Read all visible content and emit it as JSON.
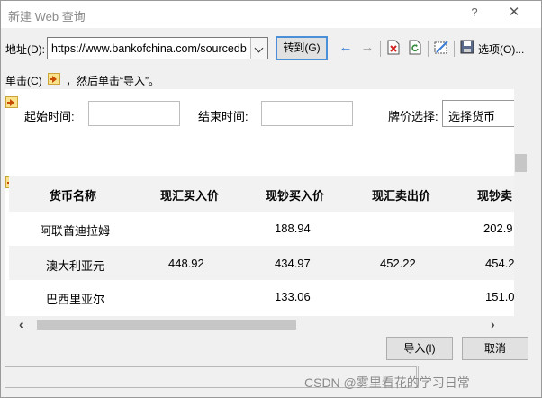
{
  "window": {
    "title": "新建 Web 查询",
    "help": "?",
    "close": "✕"
  },
  "toolbar": {
    "address_label": "地址(D):",
    "address_value": "https://www.bankofchina.com/sourcedb",
    "goto_label": "转到(G)",
    "options_label": "选项(O)..."
  },
  "hint": {
    "prefix": "单击(C)",
    "suffix": "，然后单击“导入”。"
  },
  "form": {
    "start_label": "起始时间:",
    "end_label": "结束时间:",
    "price_label": "牌价选择:",
    "currency_select": "选择货币"
  },
  "table": {
    "headers": [
      "货币名称",
      "现汇买入价",
      "现钞买入价",
      "现汇卖出价",
      "现钞卖"
    ],
    "rows": [
      [
        "阿联酋迪拉姆",
        "",
        "188.94",
        "",
        "202.9"
      ],
      [
        "澳大利亚元",
        "448.92",
        "434.97",
        "452.22",
        "454.2"
      ],
      [
        "巴西里亚尔",
        "",
        "133.06",
        "",
        "151.0"
      ]
    ]
  },
  "buttons": {
    "import": "导入(I)",
    "cancel": "取消"
  },
  "watermark": "CSDN @雾里看花的学习日常"
}
